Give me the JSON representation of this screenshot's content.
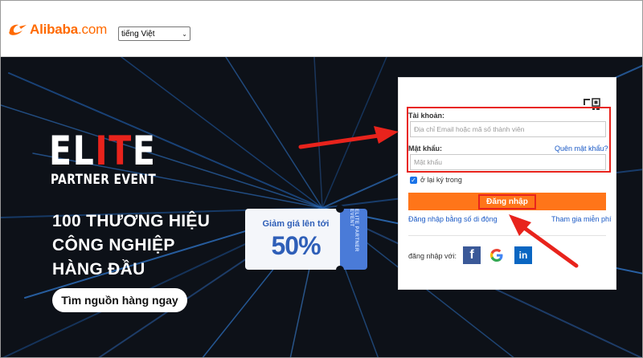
{
  "header": {
    "logo_text": "Alibaba",
    "logo_suffix": ".com",
    "language": "tiếng Việt"
  },
  "hero": {
    "elite_prefix": "EL",
    "elite_red": "IT",
    "elite_suffix": "E",
    "partner_event": "PARTNER EVENT",
    "headline_lines": [
      "100 THƯƠNG HIỆU",
      "CÔNG NGHIỆP",
      "HÀNG ĐẦU"
    ],
    "cta_label": "Tìm nguồn hàng ngay",
    "ticket_line1": "Giảm giá lên tới",
    "ticket_line2": "50%",
    "ticket_stub": "ELITE PARTNER EVENT"
  },
  "login": {
    "account_label": "Tài khoản:",
    "account_placeholder": "Địa chỉ Email hoặc mã số thành viên",
    "password_label": "Mật khẩu:",
    "forgot_label": "Quên mật khẩu?",
    "password_placeholder": "Mật khẩu",
    "remember_label": "ở lại ký trong",
    "login_button": "Đăng nhập",
    "phone_login": "Đăng nhập bằng số di động",
    "join_free": "Tham gia miễn phí",
    "social_label": "đăng nhập với:",
    "social": [
      "facebook-icon",
      "google-icon",
      "linkedin-icon"
    ]
  },
  "colors": {
    "brand_orange": "#ff6a00",
    "button_orange": "#ff7519",
    "highlight_red": "#e8231c",
    "link_blue": "#1b5ac6",
    "hero_bg": "#0d1118"
  }
}
